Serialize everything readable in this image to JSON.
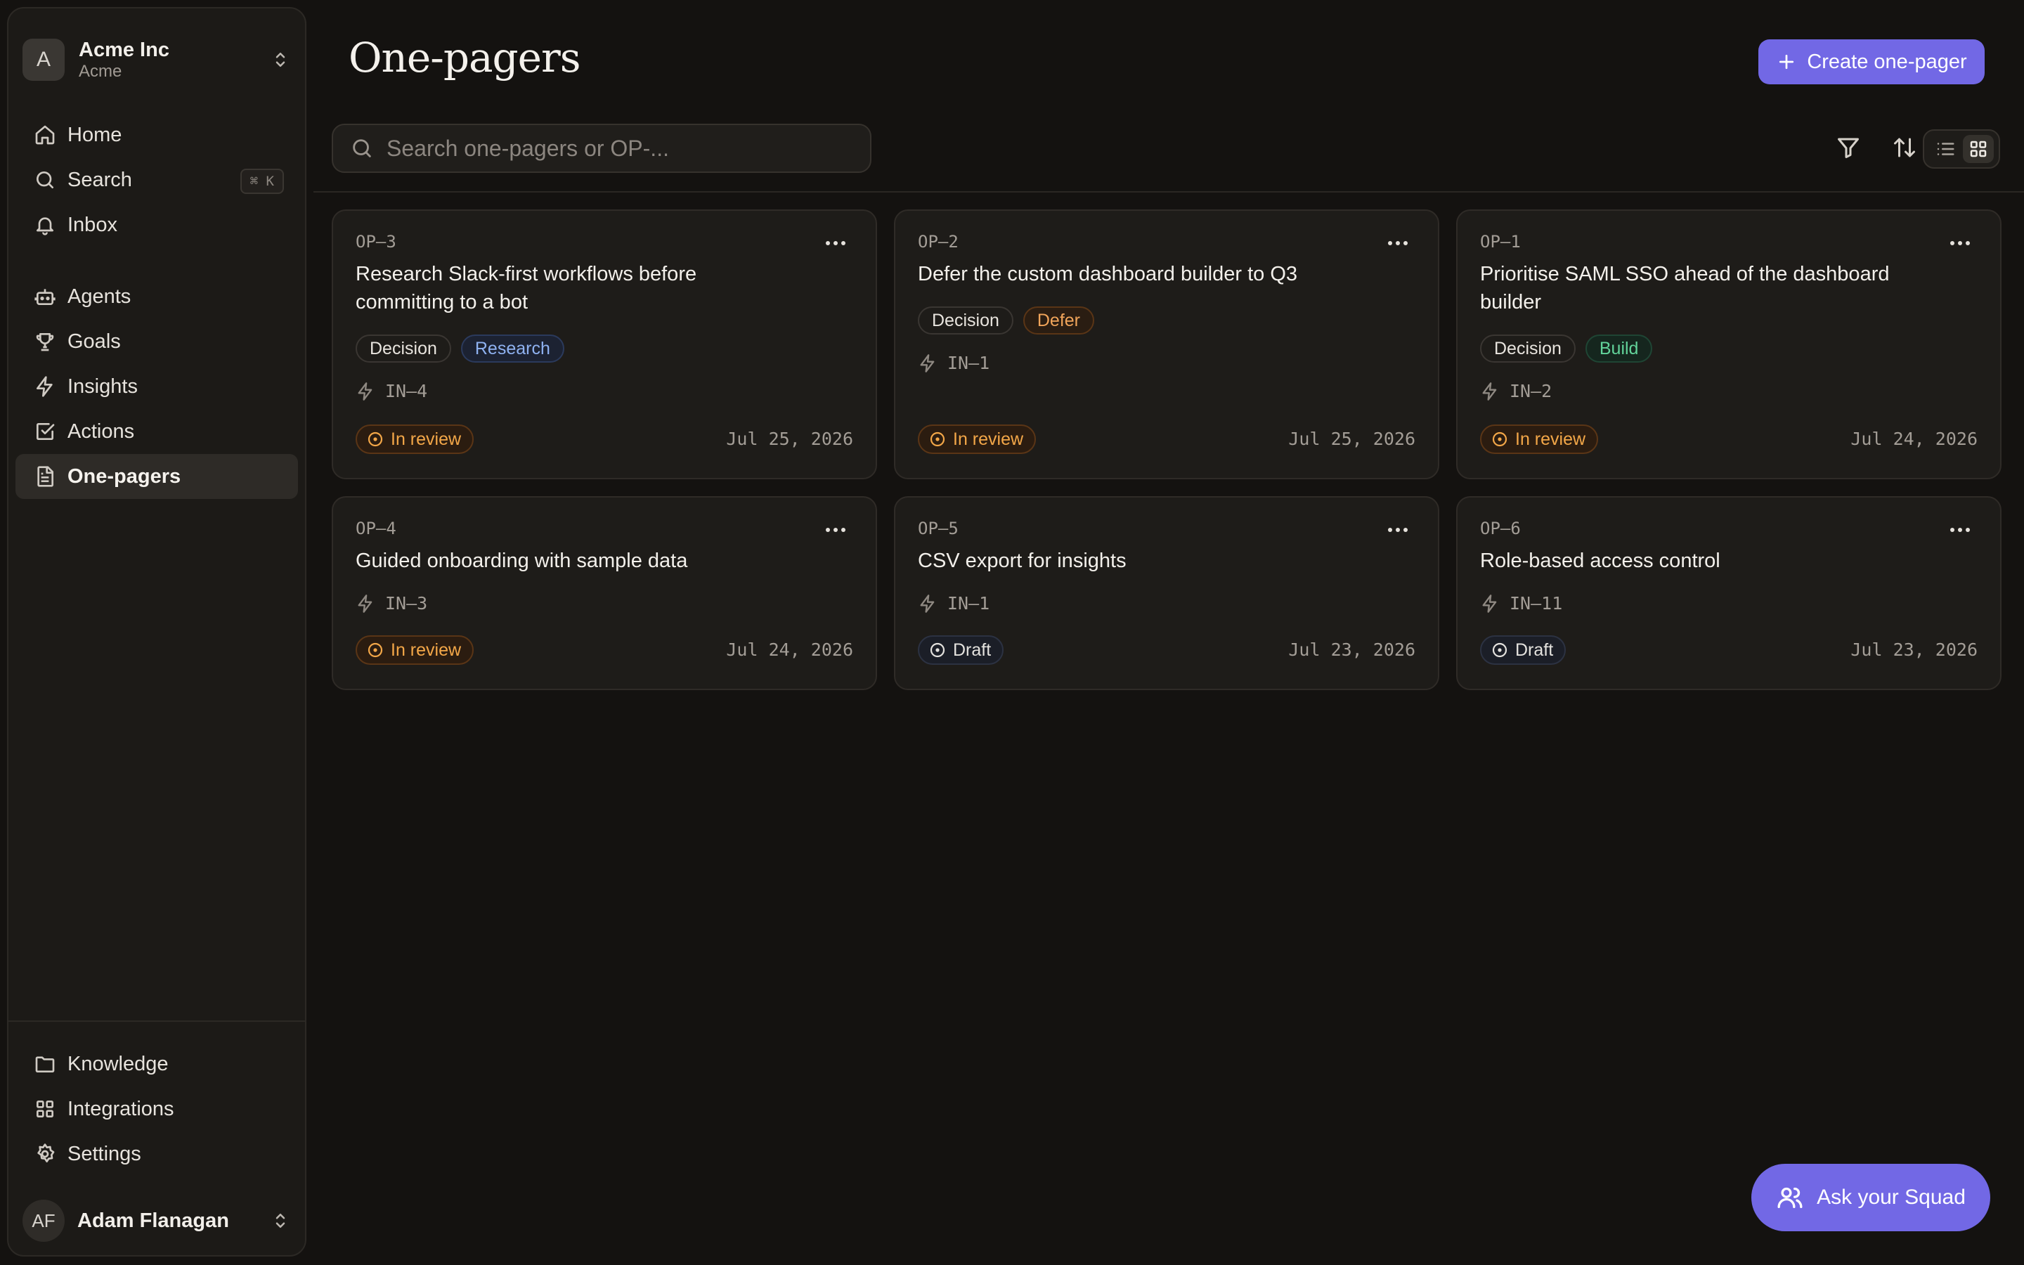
{
  "sidebar": {
    "org": {
      "avatar": "A",
      "name": "Acme Inc",
      "subtitle": "Acme"
    },
    "nav_top": [
      {
        "label": "Home",
        "icon": "home-icon"
      },
      {
        "label": "Search",
        "icon": "search-icon",
        "shortcut": "⌘ K"
      },
      {
        "label": "Inbox",
        "icon": "bell-icon"
      }
    ],
    "nav_mid": [
      {
        "label": "Agents",
        "icon": "robot-icon"
      },
      {
        "label": "Goals",
        "icon": "trophy-icon"
      },
      {
        "label": "Insights",
        "icon": "lightning-icon"
      },
      {
        "label": "Actions",
        "icon": "checkbox-icon"
      },
      {
        "label": "One-pagers",
        "icon": "document-icon",
        "active": true
      }
    ],
    "nav_bottom": [
      {
        "label": "Knowledge",
        "icon": "folder-icon"
      },
      {
        "label": "Integrations",
        "icon": "grid-icon"
      },
      {
        "label": "Settings",
        "icon": "gear-icon"
      }
    ],
    "user": {
      "initials": "AF",
      "name": "Adam Flanagan"
    }
  },
  "header": {
    "title": "One-pagers",
    "create_label": "Create one-pager"
  },
  "search": {
    "placeholder": "Search one-pagers or OP-..."
  },
  "cards": [
    {
      "id": "OP–3",
      "title": "Research Slack-first workflows before committing to a bot",
      "tags": [
        "Decision",
        "Research"
      ],
      "link": "IN–4",
      "status": "In review",
      "date": "Jul 25, 2026"
    },
    {
      "id": "OP–2",
      "title": "Defer the custom dashboard builder to Q3",
      "tags": [
        "Decision",
        "Defer"
      ],
      "link": "IN–1",
      "status": "In review",
      "date": "Jul 25, 2026"
    },
    {
      "id": "OP–1",
      "title": "Prioritise SAML SSO ahead of the dashboard builder",
      "tags": [
        "Decision",
        "Build"
      ],
      "link": "IN–2",
      "status": "In review",
      "date": "Jul 24, 2026"
    },
    {
      "id": "OP–4",
      "title": "Guided onboarding with sample data",
      "tags": [],
      "link": "IN–3",
      "status": "In review",
      "date": "Jul 24, 2026"
    },
    {
      "id": "OP–5",
      "title": "CSV export for insights",
      "tags": [],
      "link": "IN–1",
      "status": "Draft",
      "date": "Jul 23, 2026"
    },
    {
      "id": "OP–6",
      "title": "Role-based access control",
      "tags": [],
      "link": "IN–11",
      "status": "Draft",
      "date": "Jul 23, 2026"
    }
  ],
  "ask_label": "Ask your Squad",
  "colors": {
    "accent": "#7268e5",
    "background": "#141210",
    "status_review": "#f3a748",
    "tag_research": "#8fb2f1",
    "tag_defer": "#f0a45a",
    "tag_build": "#62d39a"
  }
}
